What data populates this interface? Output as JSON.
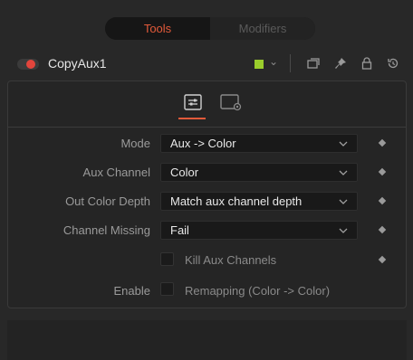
{
  "tabs": {
    "tools": "Tools",
    "modifiers": "Modifiers"
  },
  "tool": {
    "name": "CopyAux1",
    "swatch_color": "#9acd2c",
    "enabled": true
  },
  "header_icons": [
    "version-icon",
    "pin-icon",
    "lock-icon",
    "reset-icon"
  ],
  "panel_tabs": [
    "controls-icon",
    "settings-icon"
  ],
  "fields": {
    "mode": {
      "label": "Mode",
      "value": "Aux -> Color"
    },
    "aux_channel": {
      "label": "Aux Channel",
      "value": "Color"
    },
    "out_color_depth": {
      "label": "Out Color Depth",
      "value": "Match aux channel depth"
    },
    "channel_missing": {
      "label": "Channel Missing",
      "value": "Fail"
    }
  },
  "kill_aux": {
    "label": "Kill Aux Channels",
    "checked": false
  },
  "enable": {
    "label": "Enable",
    "option_label": "Remapping (Color -> Color)",
    "checked": false
  }
}
